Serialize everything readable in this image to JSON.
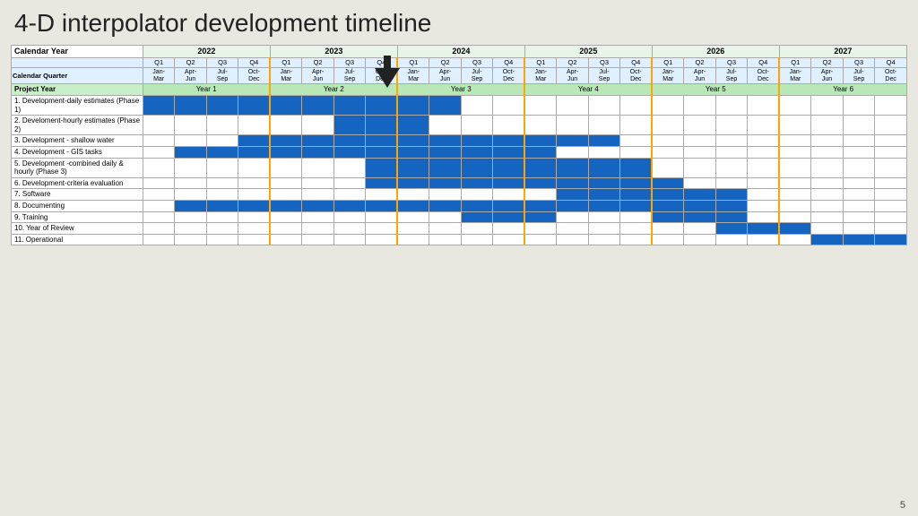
{
  "title": "4-D interpolator development timeline",
  "page_number": "5",
  "arrow": {
    "label": "current position indicator"
  },
  "calendar_year_label": "Calendar Year",
  "calendar_quarter_label": "Calendar Quarter",
  "project_year_label": "Project Year",
  "years": [
    {
      "label": "2022",
      "span": 4
    },
    {
      "label": "2023",
      "span": 4
    },
    {
      "label": "2024",
      "span": 4
    },
    {
      "label": "2025",
      "span": 4
    },
    {
      "label": "2026",
      "span": 4
    },
    {
      "label": "2027",
      "span": 4
    }
  ],
  "quarters": [
    {
      "q": "Q1",
      "m": "Jan-\nMar"
    },
    {
      "q": "Q2",
      "m": "Apr-\nJun"
    },
    {
      "q": "Q3",
      "m": "Jul-\nSep"
    },
    {
      "q": "Q4",
      "m": "Oct-\nDec"
    },
    {
      "q": "Q1",
      "m": "Jan-\nMar"
    },
    {
      "q": "Q2",
      "m": "Apr-\nJun"
    },
    {
      "q": "Q3",
      "m": "Jul-\nSep"
    },
    {
      "q": "Q4",
      "m": "Oct-\nDec"
    },
    {
      "q": "Q1",
      "m": "Jan-\nMar"
    },
    {
      "q": "Q2",
      "m": "Apr-\nJun"
    },
    {
      "q": "Q3",
      "m": "Jul-\nSep"
    },
    {
      "q": "Q4",
      "m": "Oct-\nDec"
    },
    {
      "q": "Q1",
      "m": "Jan-\nMar"
    },
    {
      "q": "Q2",
      "m": "Apr-\nJun"
    },
    {
      "q": "Q3",
      "m": "Jul-\nSep"
    },
    {
      "q": "Q4",
      "m": "Oct-\nDec"
    },
    {
      "q": "Q1",
      "m": "Jan-\nMar"
    },
    {
      "q": "Q2",
      "m": "Apr-\nJun"
    },
    {
      "q": "Q3",
      "m": "Jul-\nSep"
    },
    {
      "q": "Q4",
      "m": "Oct-\nDec"
    },
    {
      "q": "Q1",
      "m": "Jan-\nMar"
    },
    {
      "q": "Q2",
      "m": "Apr-\nJun"
    },
    {
      "q": "Q3",
      "m": "Jul-\nSep"
    },
    {
      "q": "Q4",
      "m": "Oct-\nDec"
    }
  ],
  "project_years": [
    {
      "label": "Year 1",
      "span": 4
    },
    {
      "label": "Year 2",
      "span": 4
    },
    {
      "label": "Year 3",
      "span": 4
    },
    {
      "label": "Year 4",
      "span": 4
    },
    {
      "label": "Year 5",
      "span": 4
    },
    {
      "label": "Year 6",
      "span": 4
    }
  ],
  "tasks": [
    {
      "name": "1. Development-daily estimates (Phase 1)",
      "cells": [
        1,
        1,
        1,
        1,
        1,
        1,
        1,
        1,
        1,
        1,
        0,
        0,
        0,
        0,
        0,
        0,
        0,
        0,
        0,
        0,
        0,
        0,
        0,
        0
      ]
    },
    {
      "name": "2. Develoment-hourly estimates (Phase 2)",
      "cells": [
        0,
        0,
        0,
        0,
        0,
        0,
        1,
        1,
        1,
        0,
        0,
        0,
        0,
        0,
        0,
        0,
        0,
        0,
        0,
        0,
        0,
        0,
        0,
        0
      ]
    },
    {
      "name": "3. Development - shallow water",
      "cells": [
        0,
        0,
        0,
        1,
        1,
        1,
        1,
        1,
        1,
        1,
        1,
        1,
        1,
        1,
        1,
        0,
        0,
        0,
        0,
        0,
        0,
        0,
        0,
        0
      ]
    },
    {
      "name": "4. Development - GIS tasks",
      "cells": [
        0,
        1,
        1,
        1,
        1,
        1,
        1,
        1,
        1,
        1,
        1,
        1,
        1,
        0,
        0,
        0,
        0,
        0,
        0,
        0,
        0,
        0,
        0,
        0
      ]
    },
    {
      "name": "5. Development -combined daily & hourly (Phase 3)",
      "cells": [
        0,
        0,
        0,
        0,
        0,
        0,
        0,
        1,
        1,
        1,
        1,
        1,
        1,
        1,
        1,
        1,
        0,
        0,
        0,
        0,
        0,
        0,
        0,
        0
      ]
    },
    {
      "name": "6. Development-criteria evaluation",
      "cells": [
        0,
        0,
        0,
        0,
        0,
        0,
        0,
        1,
        1,
        1,
        1,
        1,
        1,
        1,
        1,
        1,
        1,
        0,
        0,
        0,
        0,
        0,
        0,
        0
      ]
    },
    {
      "name": "7. Software",
      "cells": [
        0,
        0,
        0,
        0,
        0,
        0,
        0,
        0,
        0,
        0,
        0,
        0,
        0,
        1,
        1,
        1,
        1,
        1,
        1,
        0,
        0,
        0,
        0,
        0
      ]
    },
    {
      "name": "8. Documenting",
      "cells": [
        0,
        1,
        1,
        1,
        1,
        1,
        1,
        1,
        1,
        1,
        1,
        1,
        1,
        1,
        1,
        1,
        1,
        1,
        1,
        0,
        0,
        0,
        0,
        0
      ]
    },
    {
      "name": "9. Training",
      "cells": [
        0,
        0,
        0,
        0,
        0,
        0,
        0,
        0,
        0,
        0,
        1,
        1,
        1,
        0,
        0,
        0,
        1,
        1,
        1,
        0,
        0,
        0,
        0,
        0
      ]
    },
    {
      "name": "10. Year of Review",
      "cells": [
        0,
        0,
        0,
        0,
        0,
        0,
        0,
        0,
        0,
        0,
        0,
        0,
        0,
        0,
        0,
        0,
        0,
        0,
        1,
        1,
        1,
        0,
        0,
        0
      ]
    },
    {
      "name": "11. Operational",
      "cells": [
        0,
        0,
        0,
        0,
        0,
        0,
        0,
        0,
        0,
        0,
        0,
        0,
        0,
        0,
        0,
        0,
        0,
        0,
        0,
        0,
        0,
        1,
        1,
        1
      ]
    }
  ],
  "orange_markers": [
    4,
    8,
    12,
    16,
    20
  ]
}
